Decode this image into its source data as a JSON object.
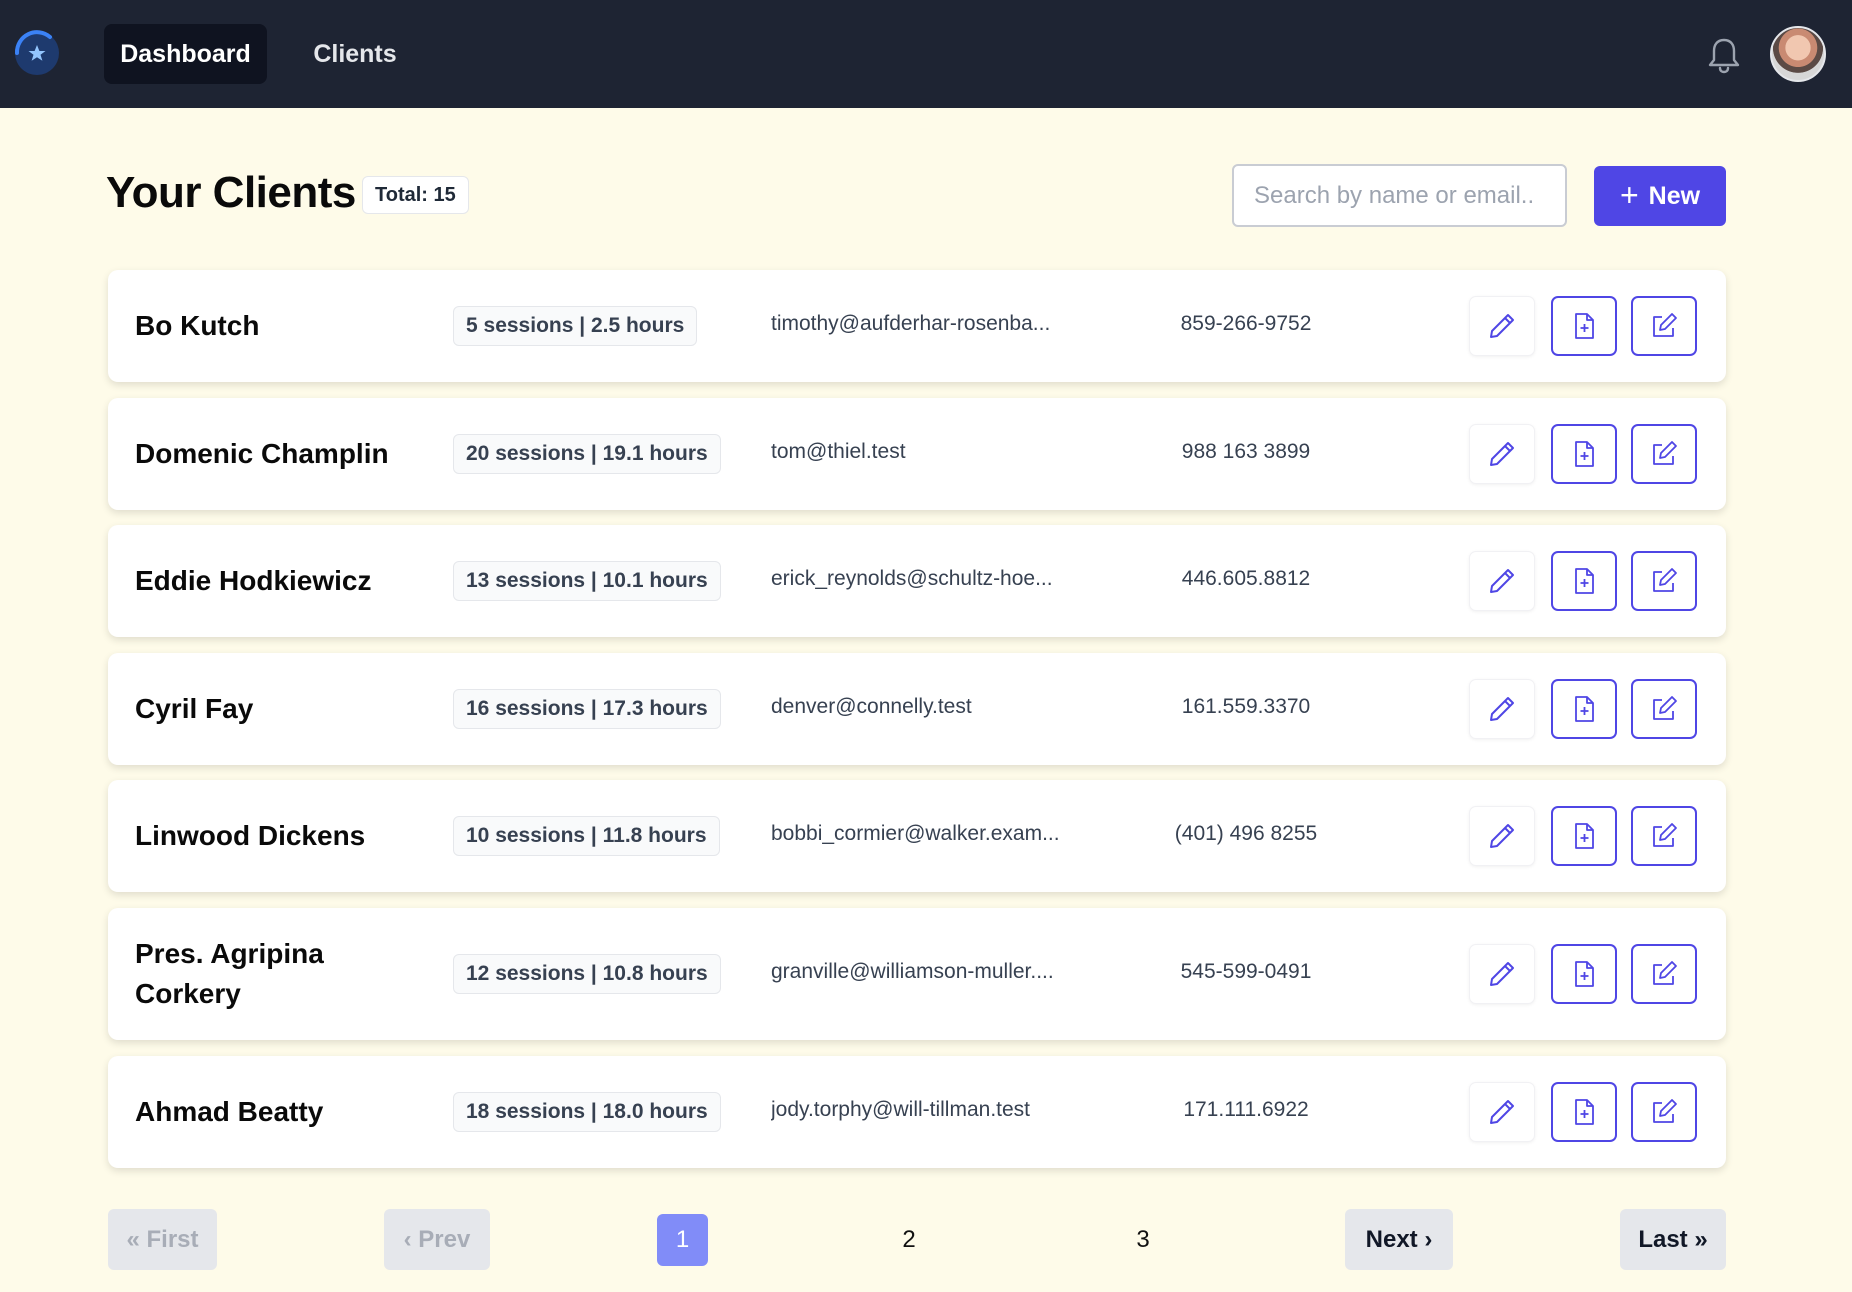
{
  "nav": {
    "tabs": [
      {
        "label": "Dashboard",
        "active": true
      },
      {
        "label": "Clients",
        "active": false
      }
    ]
  },
  "header": {
    "title": "Your Clients",
    "total": "Total: 15",
    "search_placeholder": "Search by name or email..",
    "new_label": "New"
  },
  "clients": [
    {
      "name": "Bo Kutch",
      "stats": "5 sessions | 2.5 hours",
      "email": "timothy@aufderhar-rosenba...",
      "phone": "859-266-9752"
    },
    {
      "name": "Domenic Champlin",
      "stats": "20 sessions | 19.1 hours",
      "email": "tom@thiel.test",
      "phone": "988 163 3899"
    },
    {
      "name": "Eddie Hodkiewicz",
      "stats": "13 sessions | 10.1 hours",
      "email": "erick_reynolds@schultz-hoe...",
      "phone": "446.605.8812"
    },
    {
      "name": "Cyril Fay",
      "stats": "16 sessions | 17.3 hours",
      "email": "denver@connelly.test",
      "phone": "161.559.3370"
    },
    {
      "name": "Linwood Dickens",
      "stats": "10 sessions | 11.8 hours",
      "email": "bobbi_cormier@walker.exam...",
      "phone": "(401) 496 8255"
    },
    {
      "name": "Pres. Agripina Corkery",
      "stats": "12 sessions | 10.8 hours",
      "email": "granville@williamson-muller....",
      "phone": "545-599-0491"
    },
    {
      "name": "Ahmad Beatty",
      "stats": "18 sessions | 18.0 hours",
      "email": "jody.torphy@will-tillman.test",
      "phone": "171.111.6922"
    }
  ],
  "pagination": {
    "first": "« First",
    "prev": "‹ Prev",
    "pages": [
      "1",
      "2",
      "3"
    ],
    "current": "1",
    "next": "Next ›",
    "last": "Last »"
  },
  "colors": {
    "topbar": "#1e2433",
    "background": "#fefbe9",
    "accent": "#4f46e5",
    "current_page": "#818cf8"
  },
  "icons": {
    "logo": "star-logo-icon",
    "notifications": "bell-icon",
    "edit": "pencil-icon",
    "add_document": "file-plus-icon",
    "edit_note": "pencil-square-icon"
  }
}
